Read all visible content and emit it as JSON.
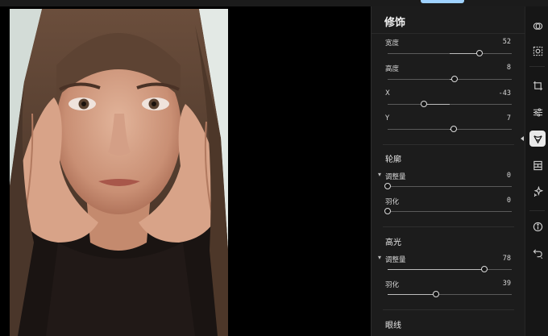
{
  "panel": {
    "title": "修饰",
    "sliders_top": [
      {
        "label": "宽度",
        "value": "52",
        "level": 0.74
      },
      {
        "label": "高度",
        "value": "8",
        "level": 0.54
      },
      {
        "label": "X",
        "value": "-43",
        "level": 0.29
      },
      {
        "label": "Y",
        "value": "7",
        "level": 0.53
      }
    ],
    "contour": {
      "title": "轮廓",
      "adjust": {
        "label": "调整量",
        "value": "0",
        "level": 0.0
      },
      "feather": {
        "label": "羽化",
        "value": "0",
        "level": 0.0
      }
    },
    "highlight": {
      "title": "高光",
      "adjust": {
        "label": "调整量",
        "value": "78",
        "level": 0.78
      },
      "feather": {
        "label": "羽化",
        "value": "39",
        "level": 0.39
      }
    },
    "eyeliner": {
      "title": "眼线"
    }
  },
  "toolbar": {
    "tools": [
      "effects-icon",
      "select-icon",
      "crop-icon",
      "adjust-icon",
      "retouch-icon",
      "frame-icon",
      "sparkle-icon",
      "info-icon",
      "undo-icon"
    ],
    "active": "retouch-icon"
  },
  "colors": {
    "panel_bg": "#1c1c1c",
    "toolbar_bg": "#161616",
    "accent": "#9fd2ff"
  }
}
